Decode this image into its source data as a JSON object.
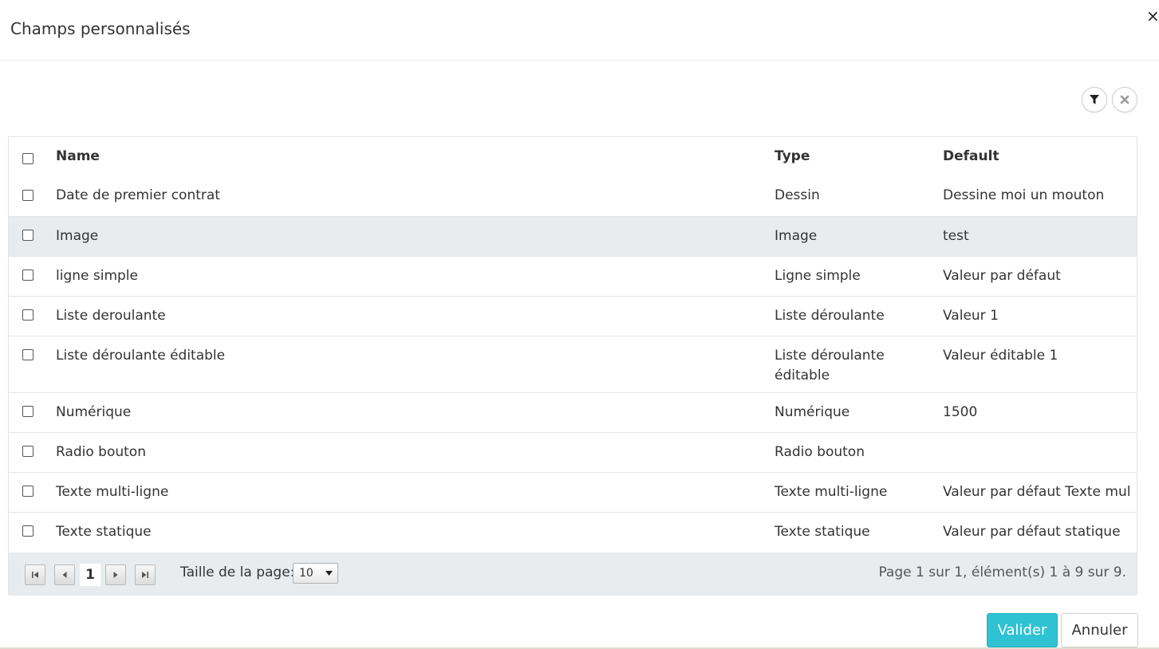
{
  "modal": {
    "title": "Champs personnalisés",
    "close_glyph": "×"
  },
  "toolbar": {
    "filter_icon": "filter-icon",
    "clear_icon": "clear-filter-icon"
  },
  "grid": {
    "columns": {
      "name": "Name",
      "type": "Type",
      "default": "Default"
    },
    "rows": [
      {
        "name": "Date de premier contrat",
        "type": "Dessin",
        "default": "Dessine moi un mouton"
      },
      {
        "name": "Image",
        "type": "Image",
        "default": "test"
      },
      {
        "name": "ligne simple",
        "type": "Ligne simple",
        "default": "Valeur par défaut"
      },
      {
        "name": "Liste deroulante",
        "type": "Liste déroulante",
        "default": "Valeur 1"
      },
      {
        "name": "Liste déroulante éditable",
        "type": "Liste déroulante éditable",
        "default": "Valeur éditable 1"
      },
      {
        "name": "Numérique",
        "type": "Numérique",
        "default": "1500"
      },
      {
        "name": "Radio bouton",
        "type": "Radio bouton",
        "default": ""
      },
      {
        "name": "Texte multi-ligne",
        "type": "Texte multi-ligne",
        "default": "Valeur par défaut Texte multi-ligne"
      },
      {
        "name": "Texte statique",
        "type": "Texte statique",
        "default": "Valeur par défaut statique"
      }
    ]
  },
  "pager": {
    "current_page": "1",
    "page_size_label": "Taille de la page:",
    "page_size": "10",
    "info": "Page 1 sur 1, élément(s) 1 à 9 sur 9."
  },
  "footer": {
    "ok_label": "Valider",
    "cancel_label": "Annuler"
  },
  "colors": {
    "accent": "#2fc2d3",
    "row_alt": "#e8ecef"
  }
}
